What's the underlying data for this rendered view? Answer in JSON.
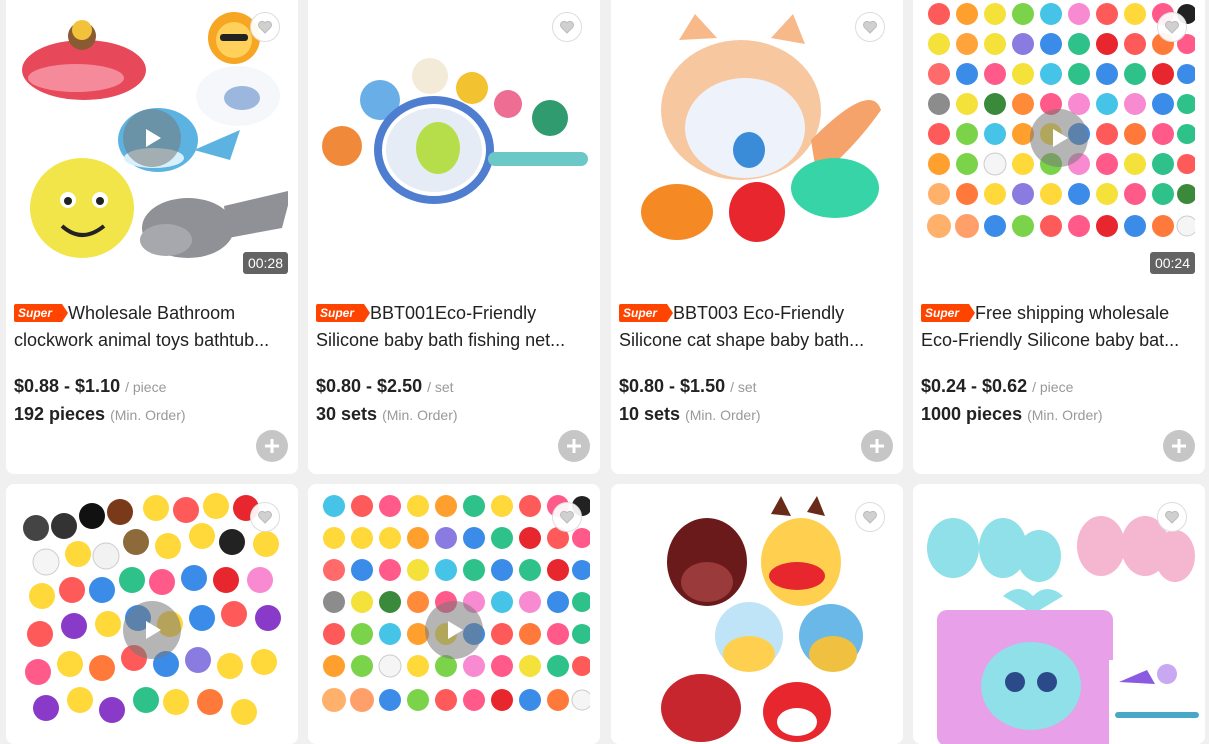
{
  "products": [
    {
      "badge": "Super",
      "title_line1": "Wholesale Bathroom",
      "title_line2": "clockwork animal toys bathtub...",
      "price": "$0.88 - $1.10",
      "unit": "/ piece",
      "moq": "192 pieces",
      "moq_label": "(Min. Order)",
      "duration": "00:28",
      "has_video": true
    },
    {
      "badge": "Super",
      "title_line1": "BBT001Eco-Friendly",
      "title_line2": "Silicone baby bath fishing net...",
      "price": "$0.80 - $2.50",
      "unit": "/ set",
      "moq": "30 sets",
      "moq_label": "(Min. Order)",
      "has_video": false
    },
    {
      "badge": "Super",
      "title_line1": "BBT003 Eco-Friendly",
      "title_line2": "Silicone cat shape baby bath...",
      "price": "$0.80 - $1.50",
      "unit": "/ set",
      "moq": "10 sets",
      "moq_label": "(Min. Order)",
      "has_video": false
    },
    {
      "badge": "Super",
      "title_line1": "Free shipping wholesale",
      "title_line2": "Eco-Friendly Silicone baby bat...",
      "price": "$0.24 - $0.62",
      "unit": "/ piece",
      "moq": "1000 pieces",
      "moq_label": "(Min. Order)",
      "duration": "00:24",
      "has_video": true
    }
  ],
  "colors": {
    "badge": "#ff4400",
    "background": "#f0f0f0",
    "card": "#ffffff",
    "add_button": "#c6c6c6"
  },
  "icons": {
    "favorite": "heart-outline-icon",
    "play": "play-icon",
    "add": "plus-circle-icon"
  }
}
